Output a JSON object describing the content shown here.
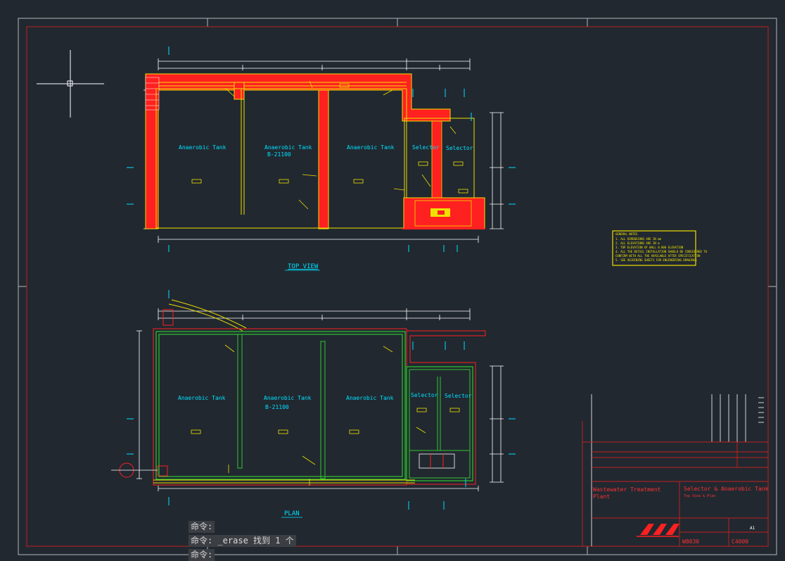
{
  "drawing": {
    "top_view": {
      "caption": "TOP VIEW",
      "tanks": [
        {
          "name": "Anaerobic Tank",
          "sub": ""
        },
        {
          "name": "Anaerobic Tank",
          "sub": "B-21100"
        },
        {
          "name": "Anaerobic Tank",
          "sub": ""
        }
      ],
      "selectors": [
        "Selector",
        "Selector"
      ]
    },
    "plan": {
      "caption": "PLAN",
      "tanks": [
        {
          "name": "Anaerobic Tank",
          "sub": ""
        },
        {
          "name": "Anaerobic Tank",
          "sub": "B-21100"
        },
        {
          "name": "Anaerobic Tank",
          "sub": ""
        }
      ],
      "selectors": [
        "Selector",
        "Selector"
      ]
    },
    "notes": {
      "title": "GENERAL NOTES",
      "lines": [
        "1. ALL DIMENSIONS ARE IN mm",
        "2. ALL ELEVATIONS ARE IN m",
        "3. TOP ELEVATION OF WALL 0.000 ELEVATION",
        "4. ALL THE DETAIL INSTALLATION SHOULD BE CONSIDERED TO",
        "   CONFIRM WITH ALL THE AVAILABLE AFTER SPECIFICATION",
        "5. SEE ADJOINING SHEETS FOR ENGINEERING DRAWINGS"
      ]
    },
    "title_block": {
      "project": "Wastewater Treatment Plant",
      "title": "Selector & Anaerobic Tank",
      "subtitle": "Top View & Plan",
      "drawing_no": "W8030",
      "sheet_size": "A1",
      "sheet": "C4000"
    }
  },
  "command_line": [
    "命令:",
    "命令: _erase 找到 1 个",
    "命令:"
  ],
  "colors": {
    "background": "#212830",
    "wall_top": "#ff2020",
    "outline_yellow": "#f0e000",
    "wall_plan": "#2ec82e",
    "dimension": "#ffffff",
    "annotation": "#00e0ff",
    "frame": "#c02020"
  }
}
